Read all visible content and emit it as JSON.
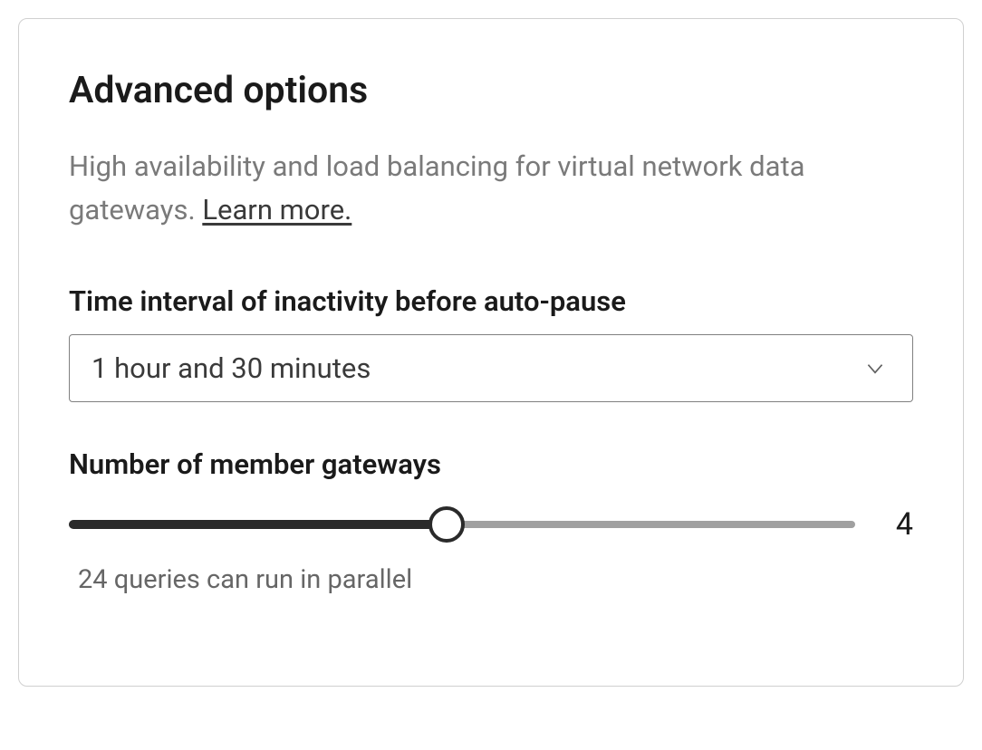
{
  "panel": {
    "heading": "Advanced options",
    "description_prefix": "High availability and load balancing for virtual network data gateways. ",
    "learn_more": "Learn more."
  },
  "time_interval": {
    "label": "Time interval of inactivity before auto-pause",
    "selected": "1 hour and 30 minutes"
  },
  "gateways": {
    "label": "Number of member gateways",
    "value": "4",
    "helper": "24 queries can run in parallel"
  }
}
